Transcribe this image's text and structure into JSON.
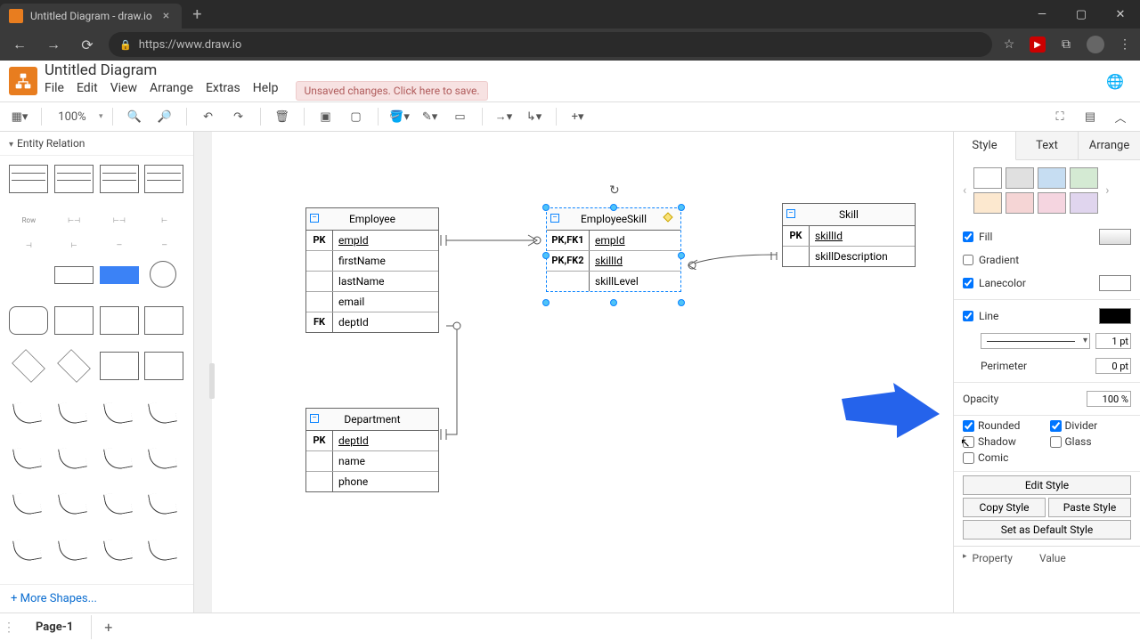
{
  "browser": {
    "tab_title": "Untitled Diagram - draw.io",
    "url": "https://www.draw.io"
  },
  "header": {
    "doc_title": "Untitled Diagram",
    "menus": [
      "File",
      "Edit",
      "View",
      "Arrange",
      "Extras",
      "Help"
    ],
    "warning": "Unsaved changes. Click here to save."
  },
  "toolbar": {
    "zoom": "100%"
  },
  "palette": {
    "title": "Entity Relation",
    "row_label": "Row",
    "more_shapes": "+ More Shapes..."
  },
  "entities": {
    "employee": {
      "title": "Employee",
      "rows": [
        {
          "key": "PK",
          "field": "empId",
          "u": true
        },
        {
          "key": "",
          "field": "firstName"
        },
        {
          "key": "",
          "field": "lastName"
        },
        {
          "key": "",
          "field": "email"
        },
        {
          "key": "FK",
          "field": "deptId"
        }
      ]
    },
    "employee_skill": {
      "title": "EmployeeSkill",
      "rows": [
        {
          "key": "PK,FK1",
          "field": "empId",
          "u": true
        },
        {
          "key": "PK,FK2",
          "field": "skillId",
          "u": true
        },
        {
          "key": "",
          "field": "skillLevel"
        }
      ]
    },
    "skill": {
      "title": "Skill",
      "rows": [
        {
          "key": "PK",
          "field": "skillId",
          "u": true
        },
        {
          "key": "",
          "field": "skillDescription"
        }
      ]
    },
    "department": {
      "title": "Department",
      "rows": [
        {
          "key": "PK",
          "field": "deptId",
          "u": true
        },
        {
          "key": "",
          "field": "name"
        },
        {
          "key": "",
          "field": "phone"
        }
      ]
    }
  },
  "right_panel": {
    "tabs": [
      "Style",
      "Text",
      "Arrange"
    ],
    "swatches_top": [
      "#ffffff",
      "#e0e0e0",
      "#c6ddf2",
      "#d4ead3"
    ],
    "swatches_bot": [
      "#fce8cf",
      "#f5d5d5",
      "#f5d5e0",
      "#e0d5ee"
    ],
    "fill": {
      "label": "Fill",
      "checked": true
    },
    "gradient": {
      "label": "Gradient",
      "checked": false
    },
    "lanecolor": {
      "label": "Lanecolor",
      "checked": true
    },
    "line": {
      "label": "Line",
      "checked": true,
      "width": "1 pt"
    },
    "perimeter": {
      "label": "Perimeter",
      "value": "0 pt"
    },
    "opacity": {
      "label": "Opacity",
      "value": "100 %"
    },
    "rounded": {
      "label": "Rounded",
      "checked": true
    },
    "divider": {
      "label": "Divider",
      "checked": true
    },
    "shadow": {
      "label": "Shadow",
      "checked": false
    },
    "glass": {
      "label": "Glass",
      "checked": false
    },
    "comic": {
      "label": "Comic",
      "checked": false
    },
    "buttons": {
      "edit": "Edit Style",
      "copy": "Copy Style",
      "paste": "Paste Style",
      "default": "Set as Default Style"
    },
    "prop_header": {
      "prop": "Property",
      "val": "Value"
    }
  },
  "footer": {
    "page": "Page-1"
  }
}
